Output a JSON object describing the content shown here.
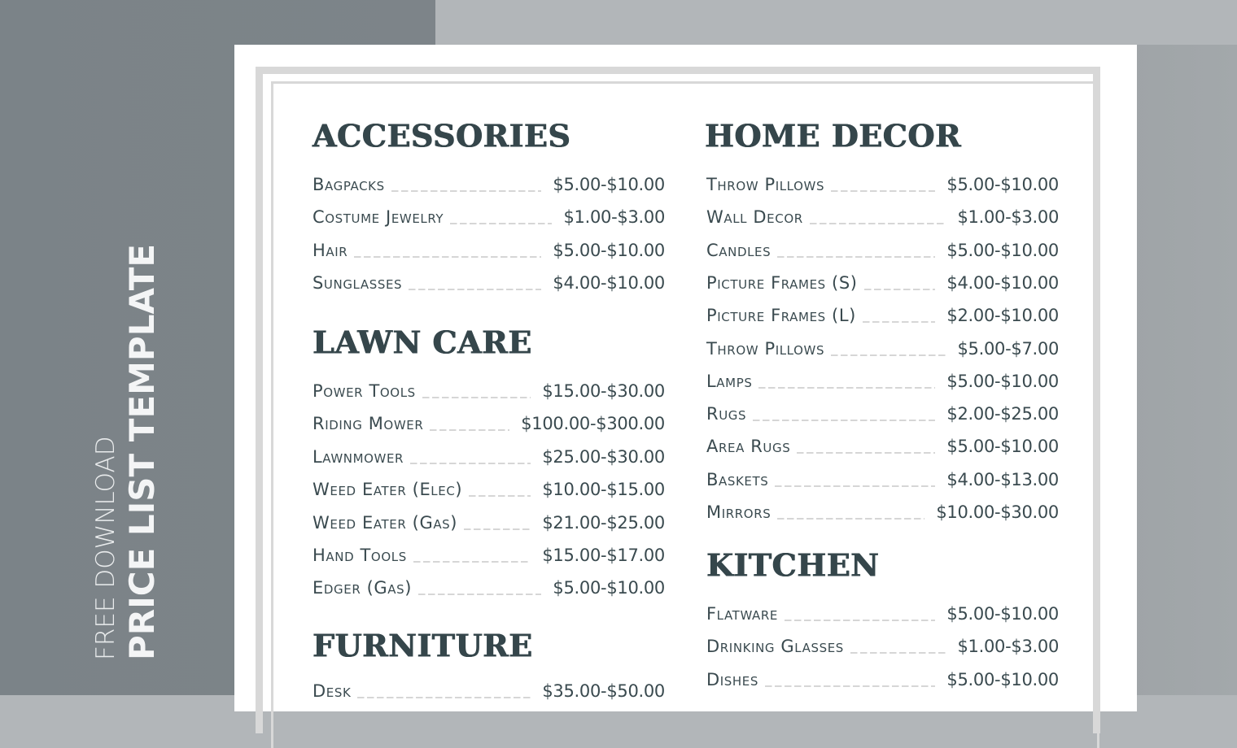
{
  "sidebar": {
    "subtitle": "FREE DOWNLOAD",
    "title": "PRICE LIST TEMPLATE"
  },
  "colors": {
    "heading": "#35464b",
    "text": "#3a4a4f",
    "frame": "#d8d8d8",
    "background_left": "#7b8388",
    "background_right": "#b2b6b9"
  },
  "sections": {
    "accessories": {
      "title": "ACCESSORIES",
      "items": [
        {
          "name": "Bagpacks",
          "price": "$5.00-$10.00"
        },
        {
          "name": "Costume Jewelry",
          "price": "$1.00-$3.00"
        },
        {
          "name": "Hair",
          "price": "$5.00-$10.00"
        },
        {
          "name": "Sunglasses",
          "price": "$4.00-$10.00"
        }
      ]
    },
    "lawn_care": {
      "title": "LAWN CARE",
      "items": [
        {
          "name": "Power Tools",
          "price": "$15.00-$30.00"
        },
        {
          "name": "Riding Mower",
          "price": "$100.00-$300.00"
        },
        {
          "name": "Lawnmower",
          "price": "$25.00-$30.00"
        },
        {
          "name": "Weed Eater (Elec)",
          "price": "$10.00-$15.00"
        },
        {
          "name": "Weed Eater (Gas)",
          "price": "$21.00-$25.00"
        },
        {
          "name": "Hand Tools",
          "price": "$15.00-$17.00"
        },
        {
          "name": "Edger (Gas)",
          "price": "$5.00-$10.00"
        }
      ]
    },
    "furniture": {
      "title": "FURNITURE",
      "items": [
        {
          "name": "Desk",
          "price": "$35.00-$50.00"
        }
      ]
    },
    "home_decor": {
      "title": "HOME DECOR",
      "items": [
        {
          "name": "Throw Pillows",
          "price": "$5.00-$10.00"
        },
        {
          "name": "Wall Decor",
          "price": "$1.00-$3.00"
        },
        {
          "name": "Candles",
          "price": "$5.00-$10.00"
        },
        {
          "name": "Picture Frames (S)",
          "price": "$4.00-$10.00"
        },
        {
          "name": "Picture Frames (L)",
          "price": "$2.00-$10.00"
        },
        {
          "name": "Throw Pillows",
          "price": "$5.00-$7.00"
        },
        {
          "name": "Lamps",
          "price": "$5.00-$10.00"
        },
        {
          "name": "Rugs",
          "price": "$2.00-$25.00"
        },
        {
          "name": "Area Rugs",
          "price": "$5.00-$10.00"
        },
        {
          "name": "Baskets",
          "price": "$4.00-$13.00"
        },
        {
          "name": "Mirrors",
          "price": "$10.00-$30.00"
        }
      ]
    },
    "kitchen": {
      "title": "KITCHEN",
      "items": [
        {
          "name": "Flatware",
          "price": "$5.00-$10.00"
        },
        {
          "name": "Drinking Glasses",
          "price": "$1.00-$3.00"
        },
        {
          "name": "Dishes",
          "price": "$5.00-$10.00"
        }
      ]
    }
  }
}
